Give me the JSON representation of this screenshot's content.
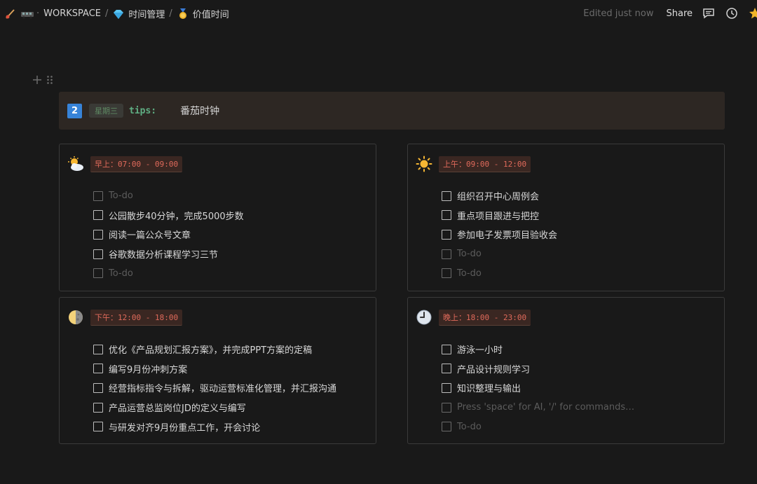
{
  "breadcrumb": {
    "workspace": "WORKSPACE",
    "page1": "时间管理",
    "page2": "价值时间",
    "separator": "/"
  },
  "header": {
    "edited": "Edited just now",
    "share": "Share"
  },
  "callout": {
    "number": "2",
    "day": "星期三",
    "tips_label": "tips:",
    "tips_text": "番茄时钟"
  },
  "cards": [
    {
      "icon": "sun-behind-cloud-icon",
      "time": "早上：07:00 - 09:00",
      "todos": [
        {
          "text": "To-do",
          "placeholder": true
        },
        {
          "text": "公园散步40分钟，完成5000步数",
          "placeholder": false
        },
        {
          "text": "阅读一篇公众号文章",
          "placeholder": false
        },
        {
          "text": "谷歌数据分析课程学习三节",
          "placeholder": false
        },
        {
          "text": "To-do",
          "placeholder": true
        }
      ]
    },
    {
      "icon": "sun-icon",
      "time": "上午：09:00 - 12:00",
      "todos": [
        {
          "text": "组织召开中心周例会",
          "placeholder": false
        },
        {
          "text": "重点项目跟进与把控",
          "placeholder": false
        },
        {
          "text": "参加电子发票项目验收会",
          "placeholder": false
        },
        {
          "text": "To-do",
          "placeholder": true
        },
        {
          "text": "To-do",
          "placeholder": true
        }
      ]
    },
    {
      "icon": "moon-icon",
      "time": "下午：12:00 - 18:00",
      "todos": [
        {
          "text": "优化《产品规划汇报方案》，并完成PPT方案的定稿",
          "placeholder": false
        },
        {
          "text": "编写9月份冲刺方案",
          "placeholder": false
        },
        {
          "text": "经营指标指令与拆解，驱动运营标准化管理，并汇报沟通",
          "placeholder": false
        },
        {
          "text": "产品运营总监岗位JD的定义与编写",
          "placeholder": false
        },
        {
          "text": "与研发对齐9月份重点工作，开会讨论",
          "placeholder": false
        }
      ]
    },
    {
      "icon": "clock-icon",
      "time": "晚上：18:00 - 23:00",
      "todos": [
        {
          "text": "游泳一小时",
          "placeholder": false
        },
        {
          "text": "产品设计规则学习",
          "placeholder": false
        },
        {
          "text": "知识整理与输出",
          "placeholder": false
        },
        {
          "text": "Press 'space' for AI, '/' for commands…",
          "placeholder": true
        },
        {
          "text": "To-do",
          "placeholder": true
        }
      ]
    }
  ],
  "colors": {
    "background": "#191919",
    "callout_bg": "#2d2723",
    "time_chip_text": "#e06a5b",
    "tips_green": "#5fae83",
    "badge_blue": "#3783d8"
  }
}
